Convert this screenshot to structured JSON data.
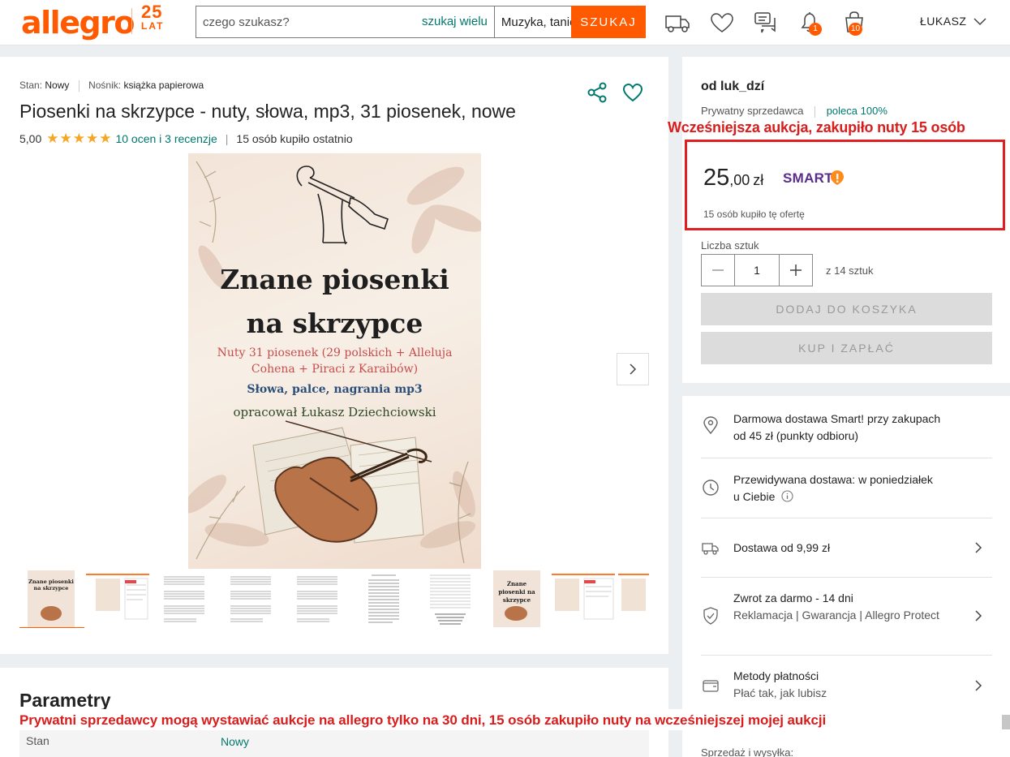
{
  "header": {
    "logo": "allegro",
    "anniv_number": "25",
    "anniv_label": "LAT",
    "search_placeholder": "czego szukasz?",
    "search_multi": "szukaj wielu",
    "category": "Muzyka, taniec, śp...",
    "search_button": "SZUKAJ",
    "notifications_badge": "1",
    "cart_badge": "10",
    "user": "ŁUKASZ",
    "accent": "#ff5a00"
  },
  "product": {
    "stan_label": "Stan:",
    "stan_value": "Nowy",
    "nosnik_label": "Nośnik:",
    "nosnik_value": "książka papierowa",
    "title": "Piosenki na skrzypce - nuty, słowa, mp3, 31 piosenek, nowe",
    "rating": "5,00",
    "stars": "★★★★★",
    "reviews": "10 ocen i 3 recenzje",
    "bought_recently": "15 osób kupiło ostatnio"
  },
  "cover": {
    "title_line1": "Znane piosenki",
    "title_line2": "na skrzypce",
    "subtitle": "Nuty 31 piosenek (29 polskich + Alleluja Cohena + Piraci z Karaibów)",
    "subtitle2": "Słowa, palce, nagrania mp3",
    "author": "opracował Łukasz Dziechciowski"
  },
  "thumbnail_titles": [
    "Znane piosenki na skrzypce",
    "Znane piosenki na skrzypce"
  ],
  "params": {
    "title": "Parametry",
    "row_key": "Stan",
    "row_value": "Nowy"
  },
  "seller": {
    "name": "od luk_dzí",
    "type": "Prywatny sprzedawca",
    "recommend": "poleca 100%"
  },
  "offer": {
    "price_main": "25",
    "price_dec": ",00",
    "currency": "zł",
    "smart": "SMART",
    "bought": "15 osób kupiło tę ofertę",
    "qty_label": "Liczba sztuk",
    "qty_value": "1",
    "qty_of": "z 14 sztuk",
    "add_to_cart": "DODAJ DO KOSZYKA",
    "buy_now": "KUP I ZAPŁAĆ"
  },
  "delivery": {
    "free_line1": "Darmowa dostawa Smart! przy zakupach",
    "free_line2": "od 45 zł (punkty odbioru)",
    "expected_line1": "Przewidywana dostawa: w poniedziałek",
    "expected_line2": "u Ciebie",
    "shipping": "Dostawa od 9,99 zł",
    "return_title": "Zwrot za darmo - 14 dni",
    "return_sub": "Reklamacja | Gwarancja | Allegro Protect",
    "payment_title": "Metody płatności",
    "payment_sub": "Płać tak, jak lubisz",
    "sale_shipping": "Sprzedaż i wysyłka:"
  },
  "annotations": {
    "top": "Wcześniejsza aukcja, zakupiło nuty 15 osób",
    "bottom": "Prywatni sprzedawcy mogą wystawiać aukcje na allegro tylko na 30 dni,  15 osób zakupiło nuty na wcześniejszej mojej aukcji",
    "color": "#d91c1c"
  }
}
